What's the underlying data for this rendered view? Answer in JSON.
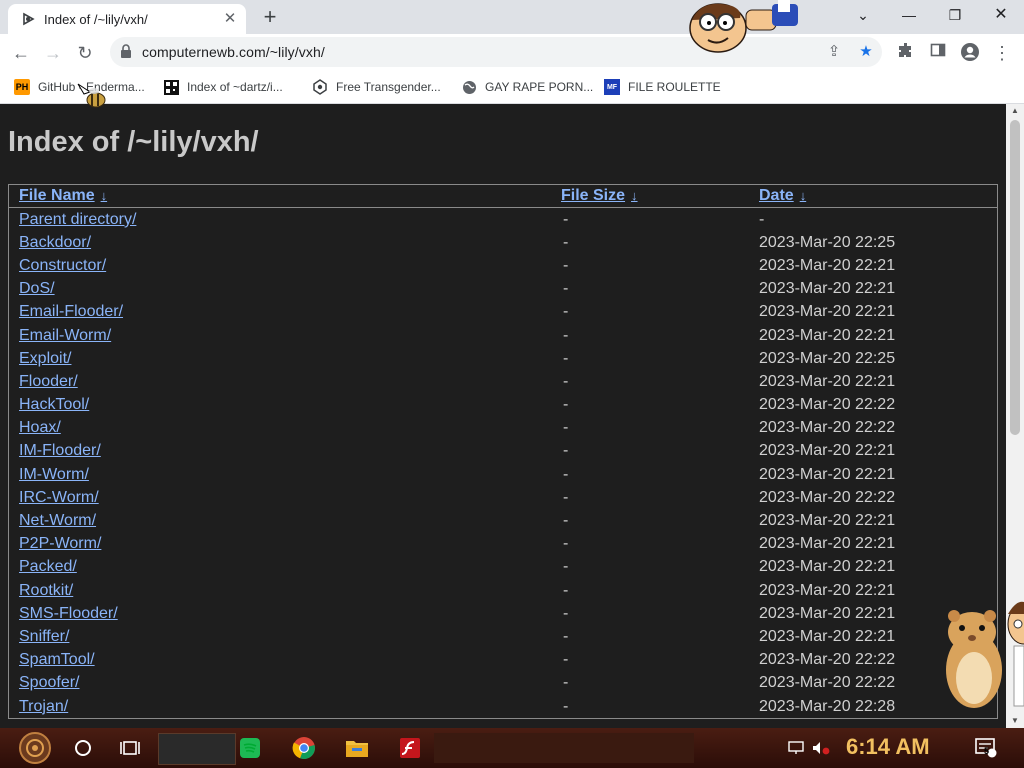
{
  "browser": {
    "tab_title": "Index of /~lily/vxh/",
    "url": "computernewb.com/~lily/vxh/",
    "window_controls": [
      "chevron-down-icon",
      "minimize-icon",
      "restore-icon",
      "close-icon"
    ]
  },
  "bookmarks": [
    {
      "label": "GitHub - Enderma...",
      "icon": "ph-logo-icon"
    },
    {
      "label": "Index of ~dartz/i...",
      "icon": "qr-icon"
    },
    {
      "label": "Free Transgender...",
      "icon": "spinner-icon"
    },
    {
      "label": "GAY RAPE PORN...",
      "icon": "globe-icon"
    },
    {
      "label": "FILE ROULETTE",
      "icon": "roulette-icon"
    }
  ],
  "page": {
    "title": "Index of /~lily/vxh/",
    "columns": {
      "name": "File Name",
      "size": "File Size",
      "date": "Date",
      "sort_arrow": "↓"
    },
    "rows": [
      {
        "name": "Parent directory/",
        "size": "-",
        "date": "-"
      },
      {
        "name": "Backdoor/",
        "size": "-",
        "date": "2023-Mar-20 22:25"
      },
      {
        "name": "Constructor/",
        "size": "-",
        "date": "2023-Mar-20 22:21"
      },
      {
        "name": "DoS/",
        "size": "-",
        "date": "2023-Mar-20 22:21"
      },
      {
        "name": "Email-Flooder/",
        "size": "-",
        "date": "2023-Mar-20 22:21"
      },
      {
        "name": "Email-Worm/",
        "size": "-",
        "date": "2023-Mar-20 22:21"
      },
      {
        "name": "Exploit/",
        "size": "-",
        "date": "2023-Mar-20 22:25"
      },
      {
        "name": "Flooder/",
        "size": "-",
        "date": "2023-Mar-20 22:21"
      },
      {
        "name": "HackTool/",
        "size": "-",
        "date": "2023-Mar-20 22:22"
      },
      {
        "name": "Hoax/",
        "size": "-",
        "date": "2023-Mar-20 22:22"
      },
      {
        "name": "IM-Flooder/",
        "size": "-",
        "date": "2023-Mar-20 22:21"
      },
      {
        "name": "IM-Worm/",
        "size": "-",
        "date": "2023-Mar-20 22:21"
      },
      {
        "name": "IRC-Worm/",
        "size": "-",
        "date": "2023-Mar-20 22:22"
      },
      {
        "name": "Net-Worm/",
        "size": "-",
        "date": "2023-Mar-20 22:21"
      },
      {
        "name": "P2P-Worm/",
        "size": "-",
        "date": "2023-Mar-20 22:21"
      },
      {
        "name": "Packed/",
        "size": "-",
        "date": "2023-Mar-20 22:21"
      },
      {
        "name": "Rootkit/",
        "size": "-",
        "date": "2023-Mar-20 22:21"
      },
      {
        "name": "SMS-Flooder/",
        "size": "-",
        "date": "2023-Mar-20 22:21"
      },
      {
        "name": "Sniffer/",
        "size": "-",
        "date": "2023-Mar-20 22:21"
      },
      {
        "name": "SpamTool/",
        "size": "-",
        "date": "2023-Mar-20 22:22"
      },
      {
        "name": "Spoofer/",
        "size": "-",
        "date": "2023-Mar-20 22:22"
      },
      {
        "name": "Trojan/",
        "size": "-",
        "date": "2023-Mar-20 22:28"
      }
    ]
  },
  "taskbar": {
    "clock": "6:14 AM",
    "notification_count": "5",
    "apps": [
      "start-orb-icon",
      "cortana-icon",
      "task-view-icon",
      "spotify-icon",
      "chrome-icon",
      "file-explorer-icon",
      "flash-icon"
    ]
  },
  "colors": {
    "page_bg": "#1e1e1e",
    "link": "#8ab4f8",
    "clock": "#f2c060",
    "taskbar": "#3a140c"
  }
}
